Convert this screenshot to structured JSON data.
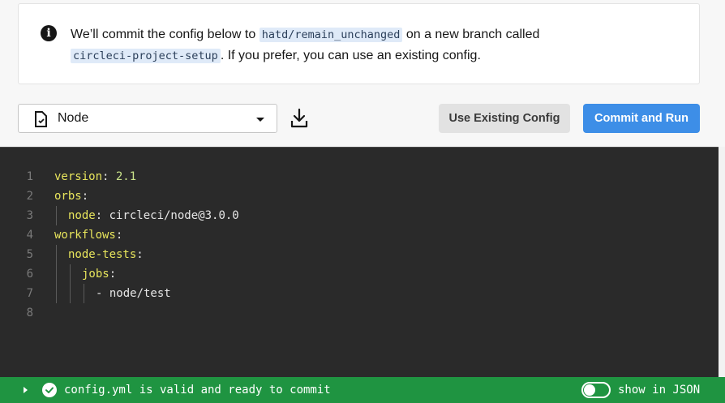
{
  "banner": {
    "icon": "info-icon",
    "text_before": "We’ll commit the config below to ",
    "branch": "hatd/remain_unchanged",
    "text_middle": " on a new branch called",
    "new_branch": "circleci-project-setup",
    "text_after": ". If you prefer, you can use an existing config."
  },
  "toolbar": {
    "template_value": "Node",
    "use_existing_label": "Use Existing Config",
    "commit_run_label": "Commit and Run",
    "primary_color": "#3d8ee7"
  },
  "editor": {
    "line_numbers": [
      "1",
      "2",
      "3",
      "4",
      "5",
      "6",
      "7",
      "8"
    ],
    "lines": [
      {
        "key": "version",
        "sep": ": ",
        "value": "2.1"
      },
      {
        "key": "orbs",
        "sep": ":",
        "value": ""
      },
      {
        "key": "node",
        "sep": ": ",
        "value": "circleci/node@3.0.0"
      },
      {
        "key": "workflows",
        "sep": ":",
        "value": ""
      },
      {
        "key": "node-tests",
        "sep": ":",
        "value": ""
      },
      {
        "key": "jobs",
        "sep": ":",
        "value": ""
      },
      {
        "key": "- ",
        "sep": "",
        "value": "node/test"
      },
      {
        "key": "",
        "sep": "",
        "value": ""
      }
    ]
  },
  "status": {
    "message": "config.yml is valid and ready to commit",
    "toggle_label": "show in JSON",
    "toggle_on": false,
    "color": "#1f9441"
  }
}
